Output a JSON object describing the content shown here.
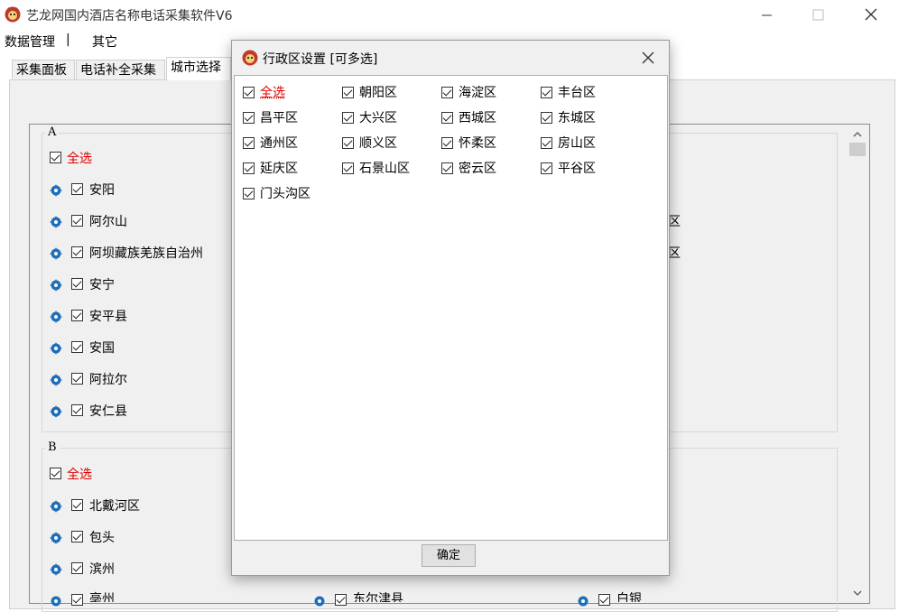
{
  "window": {
    "title": "艺龙网国内酒店名称电话采集软件V6"
  },
  "menu": {
    "items": [
      "数据管理",
      "其它"
    ],
    "separator": "|"
  },
  "tabs": [
    "采集面板",
    "电话补全采集",
    "城市选择"
  ],
  "groups": {
    "a": {
      "legend": "A",
      "select_all": "全选",
      "cities": [
        "安阳",
        "阿尔山",
        "阿坝藏族羌族自治州",
        "安宁",
        "安平县",
        "安国",
        "阿拉尔",
        "安仁县"
      ],
      "right_partial": [
        "区",
        "区"
      ]
    },
    "b": {
      "legend": "B",
      "select_all": "全选",
      "cities": [
        "北戴河区",
        "包头",
        "滨州",
        "亳州"
      ],
      "col2_partial": [
        "东尔津县"
      ],
      "col3_partial": [
        "白银"
      ]
    }
  },
  "dialog": {
    "title": "行政区设置 [可多选]",
    "districts": [
      "全选",
      "朝阳区",
      "海淀区",
      "丰台区",
      "昌平区",
      "大兴区",
      "西城区",
      "东城区",
      "通州区",
      "顺义区",
      "怀柔区",
      "房山区",
      "延庆区",
      "石景山区",
      "密云区",
      "平谷区",
      "门头沟区"
    ],
    "ok_label": "确定"
  },
  "colors": {
    "accent_red": "#e00000",
    "gear_blue": "#1e6fb8"
  }
}
